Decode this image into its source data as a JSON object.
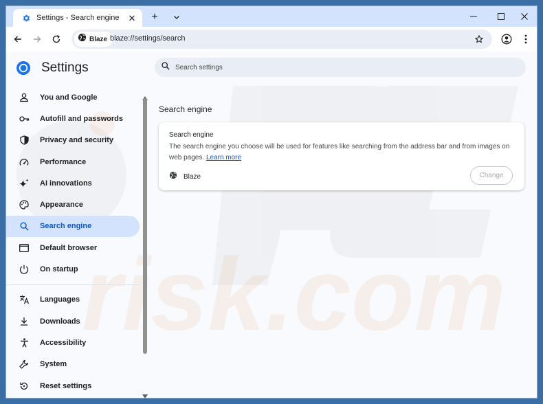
{
  "tab": {
    "title": "Settings - Search engine",
    "close": "✕"
  },
  "toolbar": {
    "new_tab": "+",
    "site_chip": "Blaze",
    "url": "blaze://settings/search"
  },
  "sidebar": {
    "title": "Settings",
    "items": [
      {
        "label": "You and Google",
        "icon": "person-icon"
      },
      {
        "label": "Autofill and passwords",
        "icon": "key-icon"
      },
      {
        "label": "Privacy and security",
        "icon": "shield-icon"
      },
      {
        "label": "Performance",
        "icon": "speedometer-icon"
      },
      {
        "label": "AI innovations",
        "icon": "sparkle-icon"
      },
      {
        "label": "Appearance",
        "icon": "palette-icon"
      },
      {
        "label": "Search engine",
        "icon": "search-icon",
        "active": true
      },
      {
        "label": "Default browser",
        "icon": "browser-window-icon"
      },
      {
        "label": "On startup",
        "icon": "power-icon"
      },
      {
        "label": "Languages",
        "icon": "translate-icon"
      },
      {
        "label": "Downloads",
        "icon": "download-icon"
      },
      {
        "label": "Accessibility",
        "icon": "accessibility-icon"
      },
      {
        "label": "System",
        "icon": "wrench-icon"
      },
      {
        "label": "Reset settings",
        "icon": "reset-icon"
      }
    ]
  },
  "search": {
    "placeholder": "Search settings"
  },
  "main": {
    "section_title": "Search engine",
    "card": {
      "heading": "Search engine",
      "description": "The search engine you choose will be used for features like searching from the address bar and from images on web pages.",
      "learn_more": "Learn more",
      "engine_name": "Blaze",
      "change_label": "Change"
    }
  },
  "colors": {
    "accent": "#0b57d0",
    "active_nav_bg": "#d3e3fd",
    "tab_strip": "#d3e3fd"
  }
}
